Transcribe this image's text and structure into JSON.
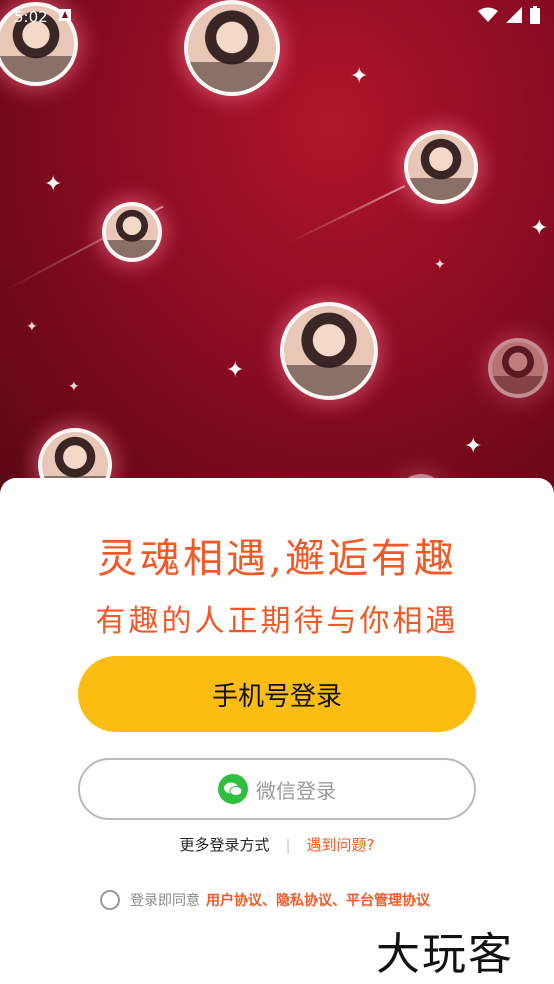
{
  "status": {
    "time": "5:02"
  },
  "headline": {
    "title": "灵魂相遇,邂逅有趣",
    "subtitle": "有趣的人正期待与你相遇"
  },
  "buttons": {
    "phone_login": "手机号登录",
    "wechat_login": "微信登录"
  },
  "links": {
    "more_login": "更多登录方式",
    "separator": "|",
    "problem": "遇到问题?"
  },
  "agreement": {
    "prefix": "登录即同意",
    "links": "用户协议、隐私协议、平台管理协议"
  },
  "watermark": "大玩客",
  "colors": {
    "accent": "#f05a28",
    "button_yellow": "#fcbd12",
    "hero_red": "#8c0c22",
    "wechat_green": "#2fbf3f"
  }
}
